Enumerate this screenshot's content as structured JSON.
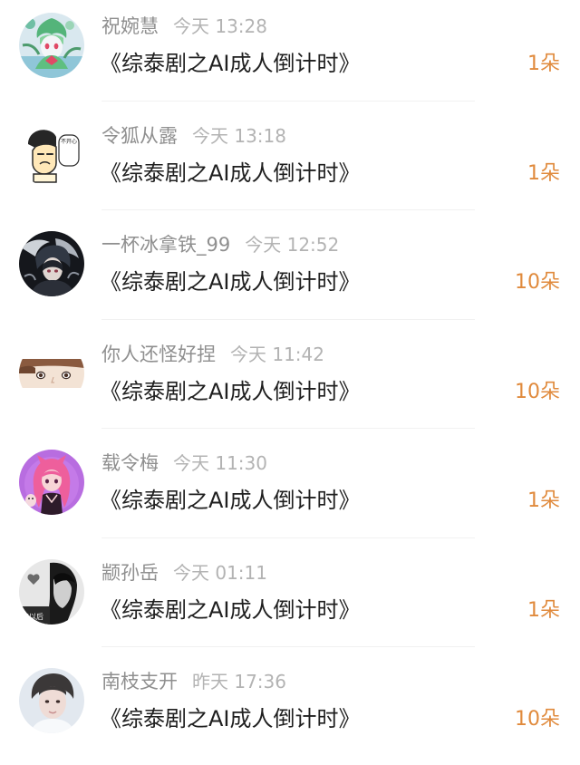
{
  "gifts": [
    {
      "name": "祝婉慧",
      "time": "今天 13:28",
      "title": "《综泰剧之AI成人倒计时》",
      "count": "1朵",
      "avatar_icon": "gardevoir-anime-avatar"
    },
    {
      "name": "令狐从露",
      "time": "今天 13:18",
      "title": "《综泰剧之AI成人倒计时》",
      "count": "1朵",
      "avatar_icon": "cartoon-sticker-avatar",
      "avatar_text": "不开心"
    },
    {
      "name": "一杯冰拿铁_99",
      "time": "今天 12:52",
      "title": "《综泰剧之AI成人倒计时》",
      "count": "10朵",
      "avatar_icon": "dark-anime-dragon-avatar"
    },
    {
      "name": "你人还怪好捏",
      "time": "今天 11:42",
      "title": "《综泰剧之AI成人倒计时》",
      "count": "10朵",
      "avatar_icon": "anime-boy-avatar"
    },
    {
      "name": "载令梅",
      "time": "今天 11:30",
      "title": "《综泰剧之AI成人倒计时》",
      "count": "1朵",
      "avatar_icon": "pink-hair-girl-avatar"
    },
    {
      "name": "颛孙岳",
      "time": "今天 01:11",
      "title": "《综泰剧之AI成人倒计时》",
      "count": "1朵",
      "avatar_icon": "monochrome-photo-avatar",
      "avatar_text": "年以后"
    },
    {
      "name": "南枝支开",
      "time": "昨天 17:36",
      "title": "《综泰剧之AI成人倒计时》",
      "count": "10朵",
      "avatar_icon": "portrait-photo-avatar"
    }
  ],
  "colors": {
    "name": "#8f8f8f",
    "time": "#b3b3b3",
    "title": "#1f1f1f",
    "count": "#e08a3c"
  }
}
